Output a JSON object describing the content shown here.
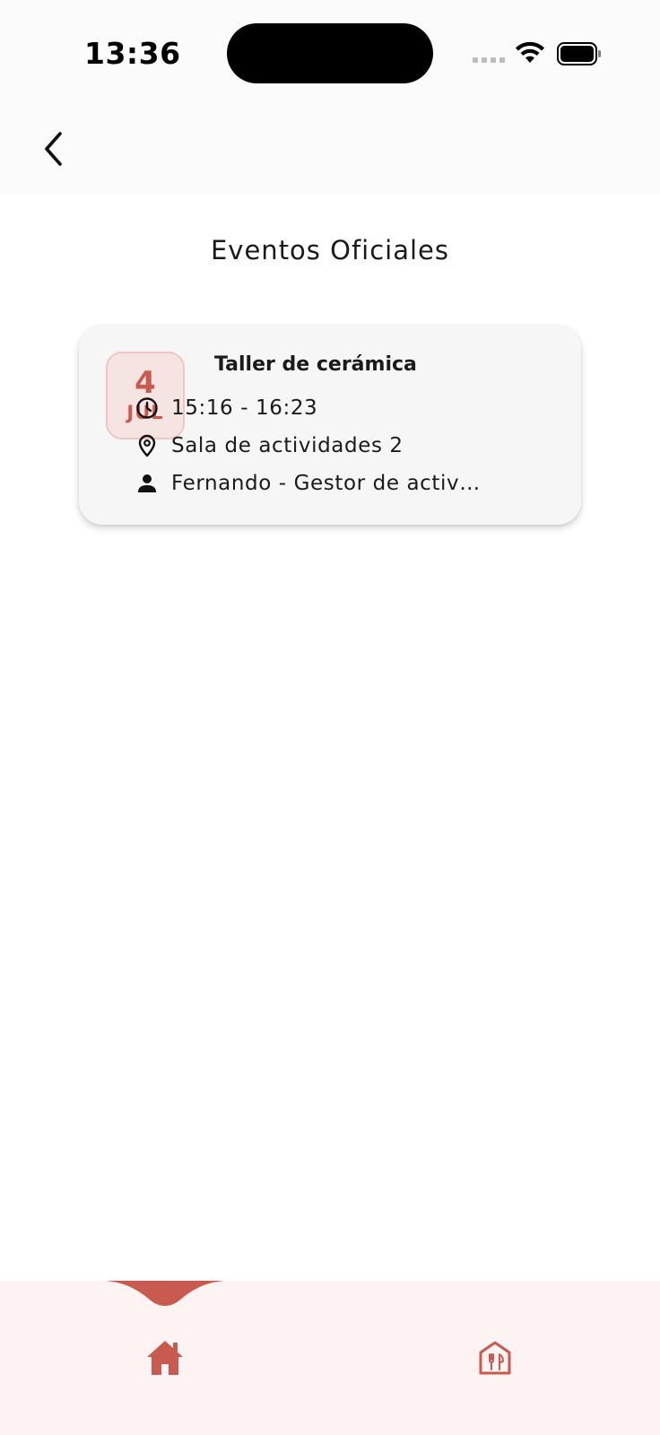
{
  "status_bar": {
    "time": "13:36"
  },
  "app_bar": {
    "back_icon": "chevron-left-icon"
  },
  "page": {
    "title": "Eventos Oficiales"
  },
  "events": [
    {
      "day": "4",
      "month": "JUL",
      "title": "Taller de cerámica",
      "time": "15:16 - 16:23",
      "location": "Sala de actividades 2",
      "host": "Fernando - Gestor de actividades"
    }
  ],
  "bottom_nav": {
    "items": [
      {
        "icon": "home-icon",
        "active": true
      },
      {
        "icon": "restaurant-icon",
        "active": false
      }
    ]
  },
  "colors": {
    "accent": "#c95a4f",
    "date_bg": "#f6e4e3",
    "nav_bg": "#fdf3f2",
    "card_bg": "#f6f6f6"
  }
}
